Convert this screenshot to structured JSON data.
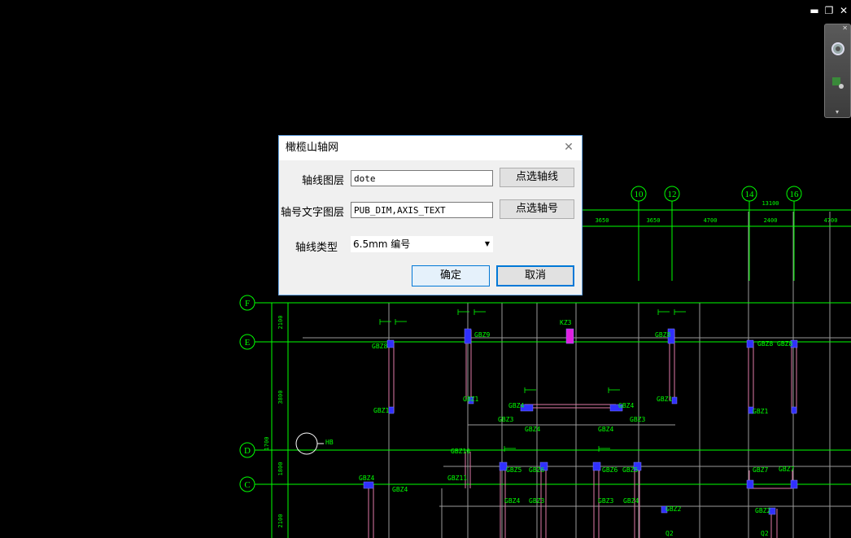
{
  "dialog": {
    "title": "橄榄山轴网",
    "close_glyph": "✕",
    "axis_layer_label": "轴线图层",
    "axis_layer_value": "dote",
    "pick_axis_button": "点选轴线",
    "text_layer_label": "轴号文字图层",
    "text_layer_value": "PUB_DIM,AXIS_TEXT",
    "pick_number_button": "点选轴号",
    "axis_type_label": "轴线类型",
    "axis_type_value": "6.5mm 编号",
    "ok_button": "确定",
    "cancel_button": "取消"
  },
  "window_controls": {
    "minimize": "▬",
    "restore": "❐",
    "close": "✕"
  },
  "drawing": {
    "column_axes": [
      "10",
      "12",
      "14",
      "16"
    ],
    "row_axes": [
      "F",
      "E",
      "D",
      "C"
    ],
    "top_dimensions": [
      "3650",
      "3650",
      "4700",
      "2400",
      "4700",
      "13100"
    ],
    "left_dimensions": [
      "2100",
      "3800",
      "1800",
      "2100",
      "1700"
    ],
    "column_tags": [
      "GBZ8",
      "GBZ1",
      "GBZ9",
      "GBZ1",
      "KZ3",
      "GBZ8",
      "GBZ1",
      "GBZ8",
      "GBZ8",
      "GBZ1",
      "GBZ4",
      "GBZ4",
      "GBZ3",
      "GBZ4",
      "GBZ4",
      "GBZ3",
      "GBZ5",
      "GBZ6",
      "GBZ6",
      "GBZ5",
      "GBZ4",
      "GBZ3",
      "GBZ3",
      "GBZ4",
      "GBZ7",
      "GBZ7",
      "GBZ10",
      "GBZ11",
      "GBZ4",
      "GBZ4",
      "GBZ2",
      "GBZ2",
      "Q2",
      "Q2",
      "HB"
    ]
  },
  "colors": {
    "canvas": "#000000",
    "grid": "#00ff00",
    "dialog_border": "#6aa9e9",
    "accent": "#0078d7"
  }
}
